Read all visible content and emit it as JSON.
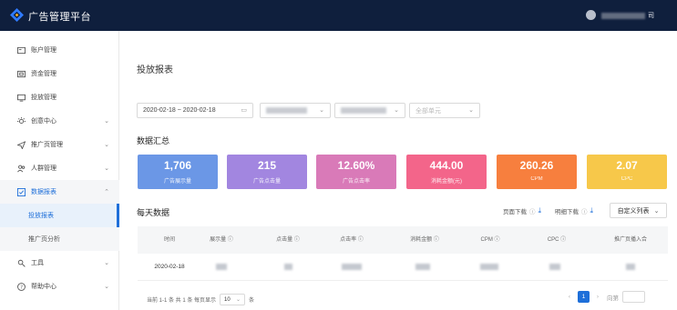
{
  "app": {
    "title": "广告管理平台"
  },
  "user": {
    "name_suffix": "司"
  },
  "sidebar": {
    "items": [
      {
        "label": "账户管理",
        "icon": "account-icon",
        "has_chevron": false
      },
      {
        "label": "资金管理",
        "icon": "wallet-icon",
        "has_chevron": false
      },
      {
        "label": "投放管理",
        "icon": "monitor-icon",
        "has_chevron": false
      },
      {
        "label": "创意中心",
        "icon": "bulb-icon",
        "has_chevron": true
      },
      {
        "label": "推广页管理",
        "icon": "send-icon",
        "has_chevron": true
      },
      {
        "label": "人群管理",
        "icon": "people-icon",
        "has_chevron": true
      },
      {
        "label": "数据报表",
        "icon": "report-icon",
        "has_chevron": true,
        "expanded": true
      }
    ],
    "subitems": [
      {
        "label": "投放报表",
        "active": true
      },
      {
        "label": "推广页分析",
        "active": false
      }
    ],
    "bottom_items": [
      {
        "label": "工具",
        "icon": "tool-icon"
      },
      {
        "label": "帮助中心",
        "icon": "help-icon"
      }
    ]
  },
  "page": {
    "title": "投放报表"
  },
  "filters": {
    "date_range": "2020-02-18  ~  2020-02-18",
    "placeholder_4": "全部单元"
  },
  "summary": {
    "title": "数据汇总",
    "cards": [
      {
        "value": "1,706",
        "label": "广告展示量",
        "color": "#6b97e6"
      },
      {
        "value": "215",
        "label": "广告点击量",
        "color": "#a286e0"
      },
      {
        "value": "12.60%",
        "label": "广告点击率",
        "color": "#d97ab8"
      },
      {
        "value": "444.00",
        "label": "消耗金额(元)",
        "color": "#f3658a"
      },
      {
        "value": "260.26",
        "label": "CPM",
        "color": "#f77f3e"
      },
      {
        "value": "2.07",
        "label": "CPC",
        "color": "#f7c84a"
      }
    ]
  },
  "daily": {
    "title": "每天数据",
    "download_page": "页面下载",
    "download_detail": "明细下载",
    "custom_columns": "自定义列表",
    "columns": [
      "时间",
      "展示量",
      "点击量",
      "点击率",
      "消耗金额",
      "CPM",
      "CPC",
      "推广页播入合"
    ],
    "rows": [
      {
        "date": "2020-02-18"
      }
    ]
  },
  "pagination": {
    "summary": "当前 1-1 条 共 1 条  每页显示",
    "page_size": "10",
    "page_size_unit": "条",
    "current_page": "1",
    "jump_label": "向第"
  }
}
